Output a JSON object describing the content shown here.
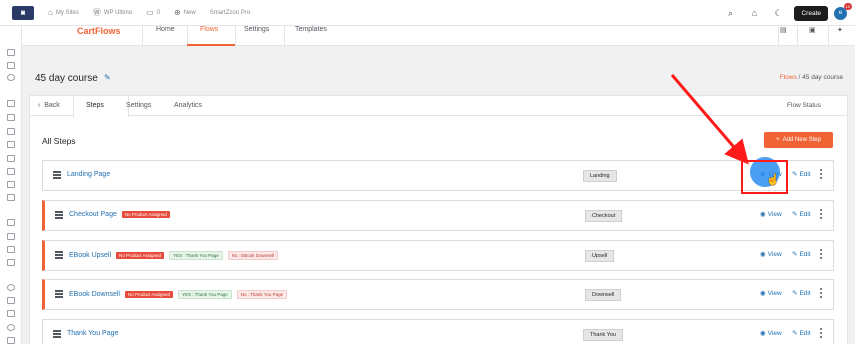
{
  "adminbar": {
    "my_sites": "My Sites",
    "wp_ultimo": "WP Ultimo",
    "comments": "0",
    "new": "New",
    "site_name": "SmartZzoo Pro",
    "create": "Create",
    "notif_count": "10"
  },
  "cartflows": {
    "logo": "CartFlows",
    "nav": [
      "Home",
      "Flows",
      "Settings",
      "Templates"
    ],
    "active_nav": "Flows"
  },
  "page": {
    "title": "45 day course",
    "breadcrumb_link": "Flows",
    "breadcrumb_rest": " / 45 day course"
  },
  "tabs": {
    "back": "Back",
    "items": [
      "Steps",
      "Settings",
      "Analytics"
    ],
    "flow_status": "Flow Status"
  },
  "steps_section": {
    "heading": "All Steps",
    "add_button": "Add New Step",
    "view_label": "View",
    "edit_label": "Edit",
    "steps": [
      {
        "name": "Landing Page",
        "type": "Landing",
        "tags": []
      },
      {
        "name": "Checkout Page",
        "type": "Checkout",
        "tags": [
          "No Product Assigned"
        ]
      },
      {
        "name": "EBook Upsell",
        "type": "Upsell",
        "tags": [
          "No Product Assigned",
          "YES : Thank You Page",
          "No : EBook Downsell"
        ]
      },
      {
        "name": "EBook Downsell",
        "type": "Downsell",
        "tags": [
          "No Product Assigned",
          "YES : Thank You Page",
          "No : Thank You Page"
        ]
      },
      {
        "name": "Thank You Page",
        "type": "Thank You",
        "tags": []
      }
    ]
  },
  "colors": {
    "accent": "#f06335",
    "link": "#2271b1",
    "annotation": "#ff1a1a",
    "highlight": "#2b8ef0"
  }
}
